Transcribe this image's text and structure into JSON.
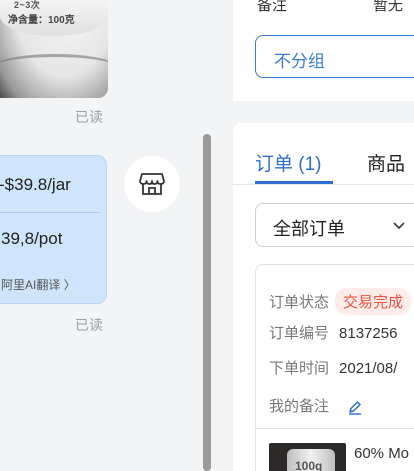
{
  "chat": {
    "image_message": {
      "text_top": "2~3次",
      "text_net": "净含量：100克"
    },
    "read_label": "已读",
    "translated_message": {
      "line1": "-$39.8/jar",
      "line2": "39,8/pot",
      "ai_translate": "阿里AI翻译 〉"
    }
  },
  "right_panel": {
    "note_label": "备注",
    "note_value": "暂无",
    "group_select_value": "不分组",
    "tabs": [
      {
        "label": "订单 (1)",
        "active": true
      },
      {
        "label": "商品",
        "active": false
      }
    ],
    "order_filter_value": "全部订单",
    "order": {
      "status_label": "订单状态",
      "status_value": "交易完成",
      "number_label": "订单编号",
      "number_value": "8137256",
      "time_label": "下单时间",
      "time_value": "2021/08/",
      "remark_label": "我的备注",
      "product_thumb_text": "100g",
      "product_name": "60% Mo"
    }
  },
  "colors": {
    "accent": "#2f6fcf",
    "bubble": "#cfe5fb",
    "status_red": "#e8533f"
  }
}
